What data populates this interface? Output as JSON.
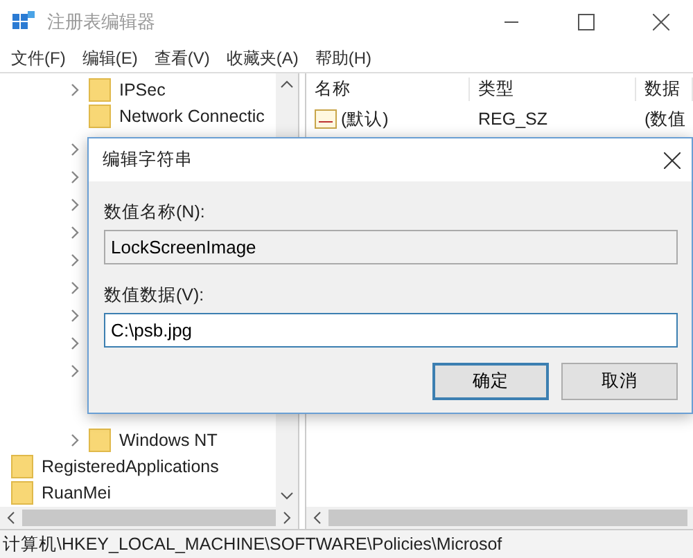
{
  "window": {
    "title": "注册表编辑器"
  },
  "menu": [
    {
      "label": "文件(F)"
    },
    {
      "label": "编辑(E)"
    },
    {
      "label": "查看(V)"
    },
    {
      "label": "收藏夹(A)"
    },
    {
      "label": "帮助(H)"
    }
  ],
  "tree": {
    "inner_items": [
      {
        "label": "IPSec",
        "expandable": true
      },
      {
        "label": "Network Connectic",
        "expandable": false
      },
      {
        "label": "Windows NT",
        "expandable": true
      }
    ],
    "outer_items": [
      {
        "label": "RegisteredApplications"
      },
      {
        "label": "RuanMei"
      }
    ]
  },
  "list": {
    "columns": [
      "名称",
      "类型",
      "数据"
    ],
    "rows": [
      {
        "name": "(默认)",
        "type": "REG_SZ",
        "data": "(数值"
      }
    ]
  },
  "dialog": {
    "title": "编辑字符串",
    "fields": [
      {
        "label": "数值名称(N):",
        "value": "LockScreenImage",
        "readonly": true,
        "focused": false
      },
      {
        "label": "数值数据(V):",
        "value": "C:\\psb.jpg",
        "readonly": false,
        "focused": true
      }
    ],
    "buttons": [
      {
        "label": "确定",
        "default": true
      },
      {
        "label": "取消",
        "default": false
      }
    ]
  },
  "status_bar": {
    "path": "计算机\\HKEY_LOCAL_MACHINE\\SOFTWARE\\Policies\\Microsof"
  }
}
